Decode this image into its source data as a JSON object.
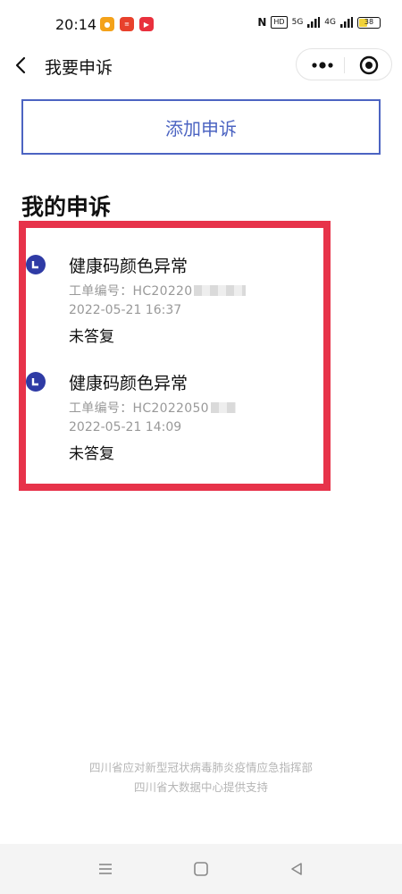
{
  "status_bar": {
    "time": "20:14",
    "app_icons": [
      "app-notification-icon",
      "news-app-icon",
      "video-app-icon"
    ],
    "nfc": "N",
    "hd": "HD",
    "net1": "5G",
    "net2": "4G",
    "battery": "38"
  },
  "header": {
    "back_icon": "chevron-left-icon",
    "title": "我要申诉",
    "more_icon": "more-dots-icon",
    "close_icon": "target-circle-icon"
  },
  "add_button": {
    "label": "添加申诉"
  },
  "section": {
    "title": "我的申诉"
  },
  "appeals": [
    {
      "title": "健康码颜色异常",
      "order_label": "工单编号：",
      "order_no": "HC20220",
      "time": "2022-05-21 16:37",
      "status": "未答复"
    },
    {
      "title": "健康码颜色异常",
      "order_label": "工单编号：",
      "order_no": "HC2022050",
      "time": "2022-05-21 14:09",
      "status": "未答复"
    }
  ],
  "footer": {
    "line1": "四川省应对新型冠状病毒肺炎疫情应急指挥部",
    "line2": "四川省大数据中心提供支持"
  },
  "colors": {
    "accent": "#4c64c2",
    "highlight_border": "#e7334a",
    "item_icon": "#2f3ba5"
  }
}
